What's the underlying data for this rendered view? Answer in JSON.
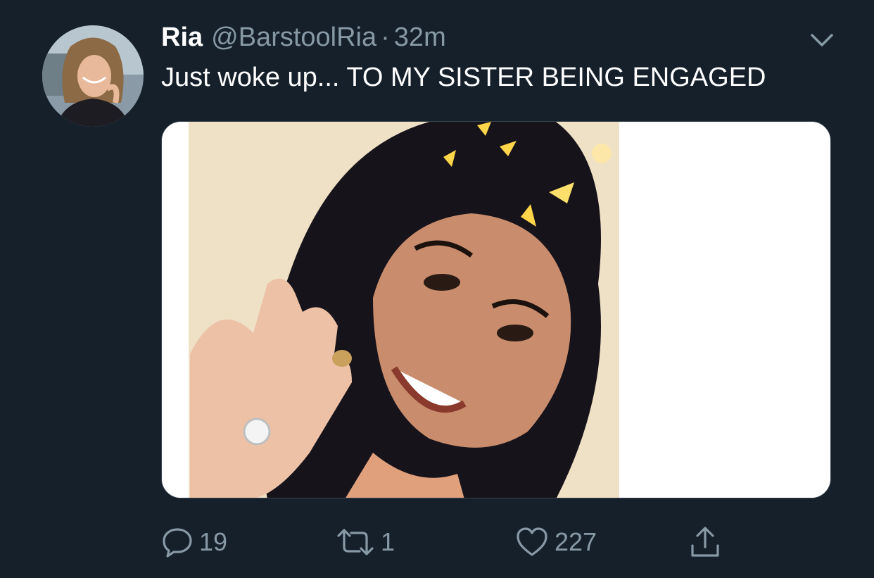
{
  "tweet": {
    "display_name": "Ria",
    "handle": "@BarstoolRia",
    "separator": "·",
    "time": "32m",
    "text": "Just woke up... TO MY SISTER BEING ENGAGED",
    "media": {
      "kind": "photo",
      "description_icon": "photo-icon"
    }
  },
  "actions": {
    "reply": {
      "icon": "reply-icon",
      "count": "19"
    },
    "retweet": {
      "icon": "retweet-icon",
      "count": "1"
    },
    "like": {
      "icon": "heart-icon",
      "count": "227"
    },
    "share": {
      "icon": "share-icon"
    }
  },
  "colors": {
    "background": "#15202b",
    "primary_text": "#ffffff",
    "secondary_text": "#8899a6",
    "media_background": "#ffffff"
  }
}
